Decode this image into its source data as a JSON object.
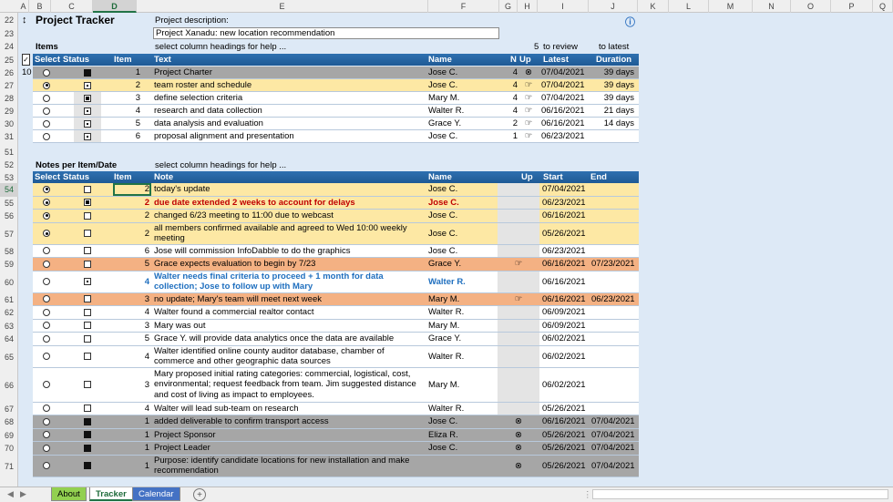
{
  "columns": [
    "A",
    "B",
    "C",
    "D",
    "E",
    "F",
    "G",
    "H",
    "I",
    "J",
    "K",
    "L",
    "M",
    "N",
    "O",
    "P",
    "Q"
  ],
  "selected_column": "D",
  "top": {
    "title": "Project Tracker",
    "desc_label": "Project description:",
    "desc_value": "Project Xanadu: new location recommendation",
    "items_label": "Items",
    "help_text": "select column headings for help ...",
    "review_count": "5",
    "to_review": "to review",
    "to_latest": "to latest",
    "info_icon": "info-icon"
  },
  "items_table": {
    "headers": [
      "Select",
      "Status",
      "Item",
      "Text",
      "Name",
      "N",
      "Up",
      "Latest",
      "Duration"
    ],
    "count": "10",
    "rows": [
      {
        "row": "26",
        "radio": "off",
        "status": "solid",
        "item": "1",
        "text": "Project Charter",
        "name": "Jose C.",
        "n": "4",
        "up": "⊗",
        "latest": "07/04/2021",
        "duration": "39 days",
        "bg": "grey"
      },
      {
        "row": "27",
        "radio": "on",
        "status": "half",
        "item": "2",
        "text": "team roster and schedule",
        "name": "Jose C.",
        "n": "4",
        "up": "☞",
        "latest": "07/04/2021",
        "duration": "39 days",
        "bg": "yellow"
      },
      {
        "row": "28",
        "radio": "off",
        "status": "filledbox",
        "item": "3",
        "text": "define selection criteria",
        "name": "Mary M.",
        "n": "4",
        "up": "☞",
        "latest": "07/04/2021",
        "duration": "39 days",
        "bg": "white"
      },
      {
        "row": "29",
        "radio": "off",
        "status": "half",
        "item": "4",
        "text": "research and data collection",
        "name": "Walter R.",
        "n": "4",
        "up": "☞",
        "latest": "06/16/2021",
        "duration": "21 days",
        "bg": "white"
      },
      {
        "row": "30",
        "radio": "off",
        "status": "half",
        "item": "5",
        "text": "data analysis and evaluation",
        "name": "Grace Y.",
        "n": "2",
        "up": "☞",
        "latest": "06/16/2021",
        "duration": "14 days",
        "bg": "white"
      },
      {
        "row": "31",
        "radio": "off",
        "status": "half",
        "item": "6",
        "text": "proposal alignment and presentation",
        "name": "Jose C.",
        "n": "1",
        "up": "☞",
        "latest": "06/23/2021",
        "duration": "",
        "bg": "white"
      }
    ]
  },
  "notes_section": {
    "label": "Notes per Item/Date",
    "help_text": "select column headings for help ...",
    "headers": [
      "Select",
      "Status",
      "Item",
      "Note",
      "Name",
      "Up",
      "Start",
      "End"
    ],
    "rows": [
      {
        "row": "54",
        "radio": "on",
        "status": "empty",
        "item": "2",
        "note": "today's update",
        "name": "Jose C.",
        "up": "",
        "start": "07/04/2021",
        "end": "",
        "bg": "yellow",
        "style": "",
        "h": "1",
        "selected": true
      },
      {
        "row": "55",
        "radio": "on",
        "status": "filledbox",
        "item": "2",
        "note": "due date extended 2 weeks to account for delays",
        "name": "Jose C.",
        "up": "",
        "start": "06/23/2021",
        "end": "",
        "bg": "yellow",
        "style": "red",
        "h": "1"
      },
      {
        "row": "56",
        "radio": "on",
        "status": "empty",
        "item": "2",
        "note": "changed 6/23 meeting to 11:00 due to webcast",
        "name": "Jose C.",
        "up": "",
        "start": "06/16/2021",
        "end": "",
        "bg": "yellow",
        "style": "",
        "h": "1"
      },
      {
        "row": "57",
        "radio": "on",
        "status": "empty",
        "item": "2",
        "note": "all members confirmed available and agreed to Wed 10:00 weekly meeting",
        "name": "Jose C.",
        "up": "",
        "start": "05/26/2021",
        "end": "",
        "bg": "yellow",
        "style": "",
        "h": "2"
      },
      {
        "row": "58",
        "radio": "off",
        "status": "empty",
        "item": "6",
        "note": "Jose will commission InfoDabble to do the graphics",
        "name": "Jose C.",
        "up": "",
        "start": "06/23/2021",
        "end": "",
        "bg": "white",
        "style": "",
        "h": "1"
      },
      {
        "row": "59",
        "radio": "off",
        "status": "empty",
        "item": "5",
        "note": "Grace expects evaluation to begin by 7/23",
        "name": "Grace Y.",
        "up": "☞",
        "start": "06/16/2021",
        "end": "07/23/2021",
        "bg": "orange",
        "style": "",
        "h": "1"
      },
      {
        "row": "60",
        "radio": "off",
        "status": "half",
        "item": "4",
        "note": "Walter needs final criteria to proceed + 1 month for data collection; Jose to follow up with Mary",
        "name": "Walter R.",
        "up": "",
        "start": "06/16/2021",
        "end": "",
        "bg": "white",
        "style": "blue",
        "h": "2"
      },
      {
        "row": "61",
        "radio": "off",
        "status": "empty",
        "item": "3",
        "note": "no update; Mary's team will meet next week",
        "name": "Mary M.",
        "up": "☞",
        "start": "06/16/2021",
        "end": "06/23/2021",
        "bg": "orange",
        "style": "",
        "h": "1"
      },
      {
        "row": "62",
        "radio": "off",
        "status": "empty",
        "item": "4",
        "note": "Walter found a commercial realtor contact",
        "name": "Walter R.",
        "up": "",
        "start": "06/09/2021",
        "end": "",
        "bg": "white",
        "style": "",
        "h": "1"
      },
      {
        "row": "63",
        "radio": "off",
        "status": "empty",
        "item": "3",
        "note": "Mary was out",
        "name": "Mary M.",
        "up": "",
        "start": "06/09/2021",
        "end": "",
        "bg": "white",
        "style": "",
        "h": "1"
      },
      {
        "row": "64",
        "radio": "off",
        "status": "empty",
        "item": "5",
        "note": "Grace Y. will provide data analytics once the data are available",
        "name": "Grace Y.",
        "up": "",
        "start": "06/02/2021",
        "end": "",
        "bg": "white",
        "style": "",
        "h": "1"
      },
      {
        "row": "65",
        "radio": "off",
        "status": "empty",
        "item": "4",
        "note": "Walter identified online county auditor database, chamber of commerce and other geographic data sources",
        "name": "Walter R.",
        "up": "",
        "start": "06/02/2021",
        "end": "",
        "bg": "white",
        "style": "",
        "h": "2"
      },
      {
        "row": "66",
        "radio": "off",
        "status": "empty",
        "item": "3",
        "note": "Mary proposed initial rating categories: commercial, logistical, cost, environmental; request feedback from team. Jim suggested distance and cost of living as impact to employees.",
        "name": "Mary M.",
        "up": "",
        "start": "06/02/2021",
        "end": "",
        "bg": "white",
        "style": "",
        "h": "3"
      },
      {
        "row": "67",
        "radio": "off",
        "status": "empty",
        "item": "4",
        "note": "Walter will lead sub-team on research",
        "name": "Walter R.",
        "up": "",
        "start": "05/26/2021",
        "end": "",
        "bg": "white",
        "style": "",
        "h": "1"
      },
      {
        "row": "68",
        "radio": "off",
        "status": "solid",
        "item": "1",
        "note": "added deliverable to confirm transport access",
        "name": "Jose C.",
        "up": "⊗",
        "start": "06/16/2021",
        "end": "07/04/2021",
        "bg": "grey",
        "style": "",
        "h": "1"
      },
      {
        "row": "69",
        "radio": "off",
        "status": "solid",
        "item": "1",
        "note": "Project Sponsor",
        "name": "Eliza R.",
        "up": "⊗",
        "start": "05/26/2021",
        "end": "07/04/2021",
        "bg": "grey",
        "style": "",
        "h": "1"
      },
      {
        "row": "70",
        "radio": "off",
        "status": "solid",
        "item": "1",
        "note": "Project Leader",
        "name": "Jose C.",
        "up": "⊗",
        "start": "05/26/2021",
        "end": "07/04/2021",
        "bg": "grey",
        "style": "",
        "h": "1"
      },
      {
        "row": "71",
        "radio": "off",
        "status": "solid",
        "item": "1",
        "note": "Purpose: identify candidate locations for new installation and make recommendation",
        "name": "",
        "up": "⊗",
        "start": "05/26/2021",
        "end": "07/04/2021",
        "bg": "grey",
        "style": "",
        "h": "2"
      }
    ]
  },
  "row_numbers_top": [
    "22",
    "23",
    "24",
    "25"
  ],
  "row_numbers_mid": [
    "51",
    "52",
    "53"
  ],
  "tabs": [
    "About",
    "Tracker",
    "Calendar"
  ],
  "active_tab": "Tracker",
  "tab_colors": {
    "About": "#92d050",
    "Tracker": "#ffffff",
    "Calendar": "#4472c4"
  }
}
